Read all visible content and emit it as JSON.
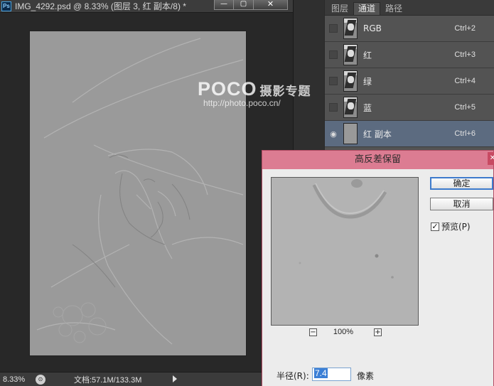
{
  "document": {
    "title": "IMG_4292.psd @ 8.33% (图层 3, 红 副本/8) *",
    "app_icon": "Ps",
    "window_buttons": {
      "minimize": "—",
      "maximize": "▢",
      "close": "✕"
    }
  },
  "watermark": {
    "logo": "POCO",
    "tagline": "摄影专题",
    "url": "http://photo.poco.cn/"
  },
  "status_bar": {
    "zoom": "8.33%",
    "doc_size": "文档:57.1M/133.3M"
  },
  "channels_panel": {
    "tabs": [
      {
        "label": "图层",
        "active": false
      },
      {
        "label": "通道",
        "active": true
      },
      {
        "label": "路径",
        "active": false
      }
    ],
    "channels": [
      {
        "name": "RGB",
        "shortcut": "Ctrl+2",
        "visible": false,
        "selected": false
      },
      {
        "name": "红",
        "shortcut": "Ctrl+3",
        "visible": false,
        "selected": false
      },
      {
        "name": "绿",
        "shortcut": "Ctrl+4",
        "visible": false,
        "selected": false
      },
      {
        "name": "蓝",
        "shortcut": "Ctrl+5",
        "visible": false,
        "selected": false
      },
      {
        "name": "红 副本",
        "shortcut": "Ctrl+6",
        "visible": true,
        "selected": true
      }
    ]
  },
  "dialog": {
    "title": "高反差保留",
    "close_glyph": "✕",
    "ok_label": "确定",
    "cancel_label": "取消",
    "preview_label": "预览(P)",
    "preview_checked": true,
    "zoom_minus": "−",
    "zoom_plus": "+",
    "zoom_percent": "100%",
    "radius_label": "半径(R):",
    "radius_value": "7.4",
    "radius_unit": "像素",
    "slider_fraction": 0.35
  },
  "colors": {
    "dialog_titlebar": "#dc7c92",
    "panel_bg": "#535353",
    "selected_row": "#5c6b80",
    "canvas_gray": "#9a9a9a"
  },
  "icons": {
    "eye": "eye-icon",
    "check": "check-icon",
    "status": "status-icon"
  }
}
